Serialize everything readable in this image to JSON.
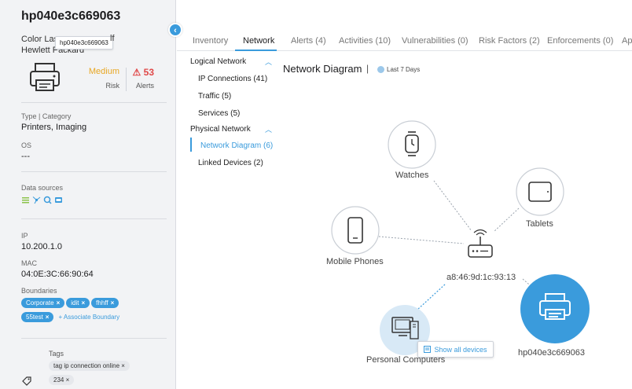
{
  "device": {
    "name": "hp040e3c669063",
    "model_prefix": "Color Las",
    "model_suffix": "lf",
    "vendor": "Hewlett Packard",
    "tooltip": "hp040e3c669063",
    "risk_level": "Medium",
    "risk_label": "Risk",
    "alerts_count": "53",
    "alerts_label": "Alerts"
  },
  "info": {
    "type_label": "Type | Category",
    "type_value": "Printers, Imaging",
    "os_label": "OS",
    "os_value": "---",
    "data_sources_label": "Data sources",
    "ip_label": "IP",
    "ip_value": "10.200.1.0",
    "mac_label": "MAC",
    "mac_value": "04:0E:3C:66:90:64",
    "boundaries_label": "Boundaries",
    "boundaries": [
      "Corporate",
      "idit",
      "fhhff",
      "55test"
    ],
    "associate_label": "+ Associate Boundary",
    "tags_label": "Tags",
    "tags": [
      "tag ip connection online",
      "234"
    ]
  },
  "tabs": [
    {
      "label": "Inventory"
    },
    {
      "label": "Network"
    },
    {
      "label": "Alerts (4)"
    },
    {
      "label": "Activities (10)"
    },
    {
      "label": "Vulnerabilities (0)"
    },
    {
      "label": "Risk Factors (2)"
    },
    {
      "label": "Enforcements (0)"
    },
    {
      "label": "Ap"
    }
  ],
  "subnav": {
    "logical_header": "Logical Network",
    "logical_items": [
      "IP Connections (41)",
      "Traffic (5)",
      "Services (5)"
    ],
    "physical_header": "Physical Network",
    "physical_items": [
      "Network Diagram (6)",
      "Linked Devices (2)"
    ]
  },
  "diagram": {
    "title": "Network Diagram",
    "separator": "|",
    "range": "Last 7 Days",
    "center_label": "a8:46:9d:1c:93:13",
    "nodes": {
      "watches": "Watches",
      "tablets": "Tablets",
      "mobile": "Mobile Phones",
      "pcs": "Personal Computers",
      "device": "hp040e3c669063"
    },
    "show_all": "Show all devices"
  },
  "colors": {
    "accent": "#3a9bdc",
    "risk_medium": "#e8a723",
    "alert_red": "#e04848"
  }
}
